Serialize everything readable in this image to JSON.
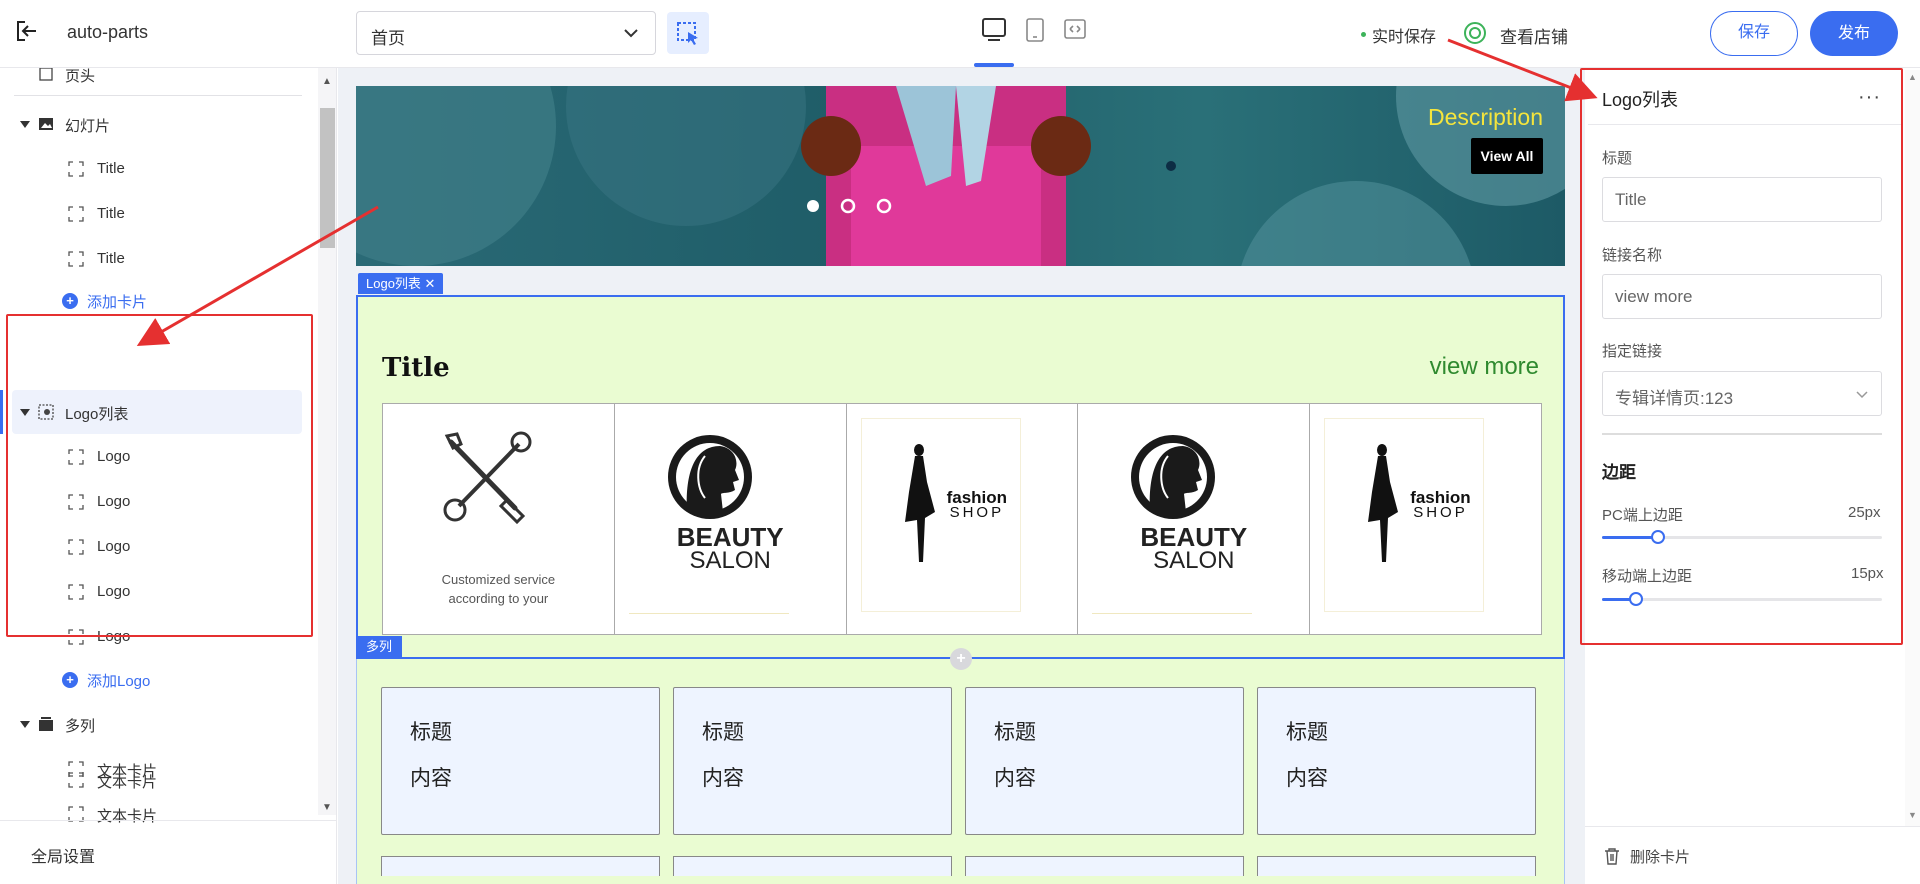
{
  "app": {
    "title": "auto-parts"
  },
  "toolbar": {
    "page_select_value": "首页",
    "save_status": "实时保存",
    "view_store": "查看店铺",
    "save_label": "保存",
    "publish_label": "发布"
  },
  "sidebar": {
    "items": [
      {
        "label": "页头"
      },
      {
        "label": "幻灯片"
      },
      {
        "label": "Title"
      },
      {
        "label": "Title"
      },
      {
        "label": "Title"
      },
      {
        "label": "添加卡片"
      },
      {
        "label": "Logo列表"
      },
      {
        "label": "Logo"
      },
      {
        "label": "Logo"
      },
      {
        "label": "Logo"
      },
      {
        "label": "Logo"
      },
      {
        "label": "Logo"
      },
      {
        "label": "添加Logo"
      },
      {
        "label": "多列"
      },
      {
        "label": "文本卡片"
      },
      {
        "label": "文本卡片"
      },
      {
        "label": "文本卡片"
      }
    ],
    "footer": "全局设置"
  },
  "canvas": {
    "banner": {
      "description": "Description",
      "view_all": "View All"
    },
    "logo_section": {
      "tag": "Logo列表 ✕",
      "title": "Title",
      "view_more": "view more",
      "logos": [
        {
          "caption_1": "Customized service",
          "caption_2": "according to your"
        },
        {
          "brand_1": "BEAUTY",
          "brand_2": "SALON"
        },
        {
          "brand_1": "fashion",
          "brand_2": "SHOP"
        },
        {
          "brand_1": "BEAUTY",
          "brand_2": "SALON"
        },
        {
          "brand_1": "fashion",
          "brand_2": "SHOP"
        }
      ]
    },
    "multi_section": {
      "tag": "多列",
      "cards": [
        {
          "title": "标题",
          "content": "内容"
        },
        {
          "title": "标题",
          "content": "内容"
        },
        {
          "title": "标题",
          "content": "内容"
        },
        {
          "title": "标题",
          "content": "内容"
        }
      ]
    }
  },
  "panel": {
    "title": "Logo列表",
    "more": "···",
    "title_label": "标题",
    "title_value": "Title",
    "link_name_label": "链接名称",
    "link_name_value": "view more",
    "link_label": "指定链接",
    "link_value": "专辑详情页:123",
    "spacing_heading": "边距",
    "pc_top_label": "PC端上边距",
    "pc_top_value": "25px",
    "pc_top_fraction": 0.2,
    "mobile_top_label": "移动端上边距",
    "mobile_top_value": "15px",
    "mobile_top_fraction": 0.12,
    "delete_label": "删除卡片"
  },
  "colors": {
    "accent": "#3a6df0",
    "annotation": "#e53030",
    "section_bg": "#eafcd2"
  }
}
